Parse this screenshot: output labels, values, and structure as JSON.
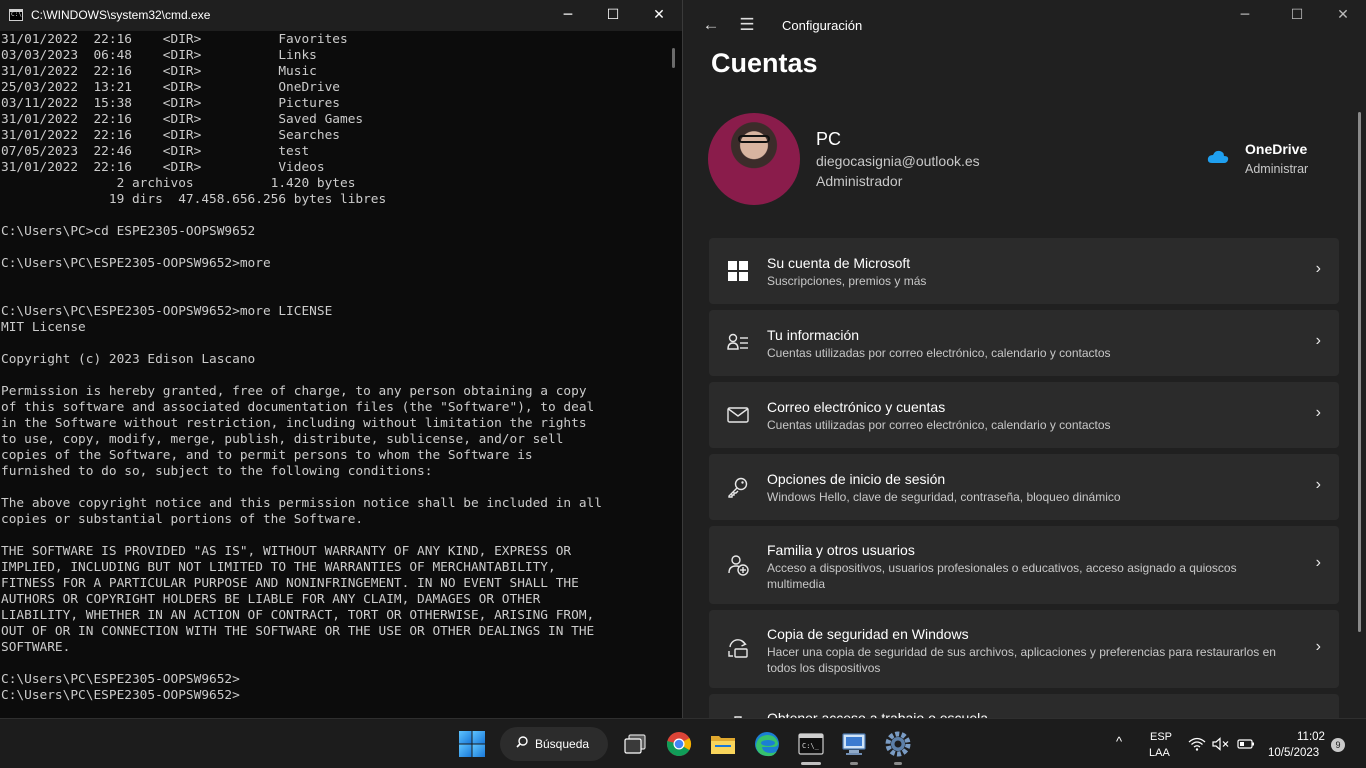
{
  "cmd": {
    "title": "C:\\WINDOWS\\system32\\cmd.exe",
    "controls": {
      "minimize": "─",
      "maximize": "☐",
      "close": "✕"
    },
    "output_lines": [
      "31/01/2022  22:16    <DIR>          Favorites",
      "03/03/2023  06:48    <DIR>          Links",
      "31/01/2022  22:16    <DIR>          Music",
      "25/03/2022  13:21    <DIR>          OneDrive",
      "03/11/2022  15:38    <DIR>          Pictures",
      "31/01/2022  22:16    <DIR>          Saved Games",
      "31/01/2022  22:16    <DIR>          Searches",
      "07/05/2023  22:46    <DIR>          test",
      "31/01/2022  22:16    <DIR>          Videos",
      "               2 archivos          1.420 bytes",
      "              19 dirs  47.458.656.256 bytes libres",
      "",
      "C:\\Users\\PC>cd ESPE2305-OOPSW9652",
      "",
      "C:\\Users\\PC\\ESPE2305-OOPSW9652>more",
      "",
      "",
      "C:\\Users\\PC\\ESPE2305-OOPSW9652>more LICENSE",
      "MIT License",
      "",
      "Copyright (c) 2023 Edison Lascano",
      "",
      "Permission is hereby granted, free of charge, to any person obtaining a copy",
      "of this software and associated documentation files (the \"Software\"), to deal",
      "in the Software without restriction, including without limitation the rights",
      "to use, copy, modify, merge, publish, distribute, sublicense, and/or sell",
      "copies of the Software, and to permit persons to whom the Software is",
      "furnished to do so, subject to the following conditions:",
      "",
      "The above copyright notice and this permission notice shall be included in all",
      "copies or substantial portions of the Software.",
      "",
      "THE SOFTWARE IS PROVIDED \"AS IS\", WITHOUT WARRANTY OF ANY KIND, EXPRESS OR",
      "IMPLIED, INCLUDING BUT NOT LIMITED TO THE WARRANTIES OF MERCHANTABILITY,",
      "FITNESS FOR A PARTICULAR PURPOSE AND NONINFRINGEMENT. IN NO EVENT SHALL THE",
      "AUTHORS OR COPYRIGHT HOLDERS BE LIABLE FOR ANY CLAIM, DAMAGES OR OTHER",
      "LIABILITY, WHETHER IN AN ACTION OF CONTRACT, TORT OR OTHERWISE, ARISING FROM,",
      "OUT OF OR IN CONNECTION WITH THE SOFTWARE OR THE USE OR OTHER DEALINGS IN THE",
      "SOFTWARE.",
      "",
      "C:\\Users\\PC\\ESPE2305-OOPSW9652>",
      "C:\\Users\\PC\\ESPE2305-OOPSW9652>"
    ]
  },
  "settings": {
    "app_title": "Configuración",
    "back_glyph": "←",
    "menu_glyph": "☰",
    "controls": {
      "minimize": "─",
      "maximize": "☐",
      "close": "✕"
    },
    "page_title": "Cuentas",
    "profile": {
      "name": "PC",
      "email": "diegocasignia@outlook.es",
      "role": "Administrador"
    },
    "onedrive": {
      "name": "OneDrive",
      "role": "Administrar"
    },
    "chevron_glyph": "›",
    "cards": [
      {
        "icon": "windows-logo-icon",
        "title": "Su cuenta de Microsoft",
        "subtitle": "Suscripciones, premios y más"
      },
      {
        "icon": "person-info-icon",
        "title": "Tu información",
        "subtitle": "Cuentas utilizadas por correo electrónico, calendario y contactos"
      },
      {
        "icon": "mail-icon",
        "title": "Correo electrónico y cuentas",
        "subtitle": "Cuentas utilizadas por correo electrónico, calendario y contactos"
      },
      {
        "icon": "key-icon",
        "title": "Opciones de inicio de sesión",
        "subtitle": "Windows Hello, clave de seguridad, contraseña, bloqueo dinámico"
      },
      {
        "icon": "family-add-icon",
        "title": "Familia y otros usuarios",
        "subtitle": "Acceso a dispositivos, usuarios profesionales o educativos, acceso asignado a quioscos multimedia"
      },
      {
        "icon": "backup-icon",
        "title": "Copia de seguridad en Windows",
        "subtitle": "Hacer una copia de seguridad de sus archivos, aplicaciones y preferencias para restaurarlos en todos los dispositivos"
      },
      {
        "icon": "briefcase-icon",
        "title": "Obtener acceso a trabajo o escuela",
        "subtitle": ""
      }
    ]
  },
  "taskbar": {
    "search_label": "Búsqueda",
    "apps": [
      "start-icon",
      "task-view-icon",
      "chrome-icon",
      "file-explorer-icon",
      "edge-icon",
      "terminal-icon",
      "remote-desktop-icon",
      "settings-gear-icon"
    ],
    "tray_chevron": "^",
    "language_line1": "ESP",
    "language_line2": "LAA",
    "time": "11:02",
    "date": "10/5/2023",
    "notification_count": "9"
  },
  "colors": {
    "terminal_bg": "#0c0c0c",
    "terminal_text": "#cccccc",
    "settings_bg": "#202020",
    "card_bg": "#2b2b2b",
    "taskbar_bg": "#1c1c1c",
    "windows_blue": "#1fa0f0"
  }
}
